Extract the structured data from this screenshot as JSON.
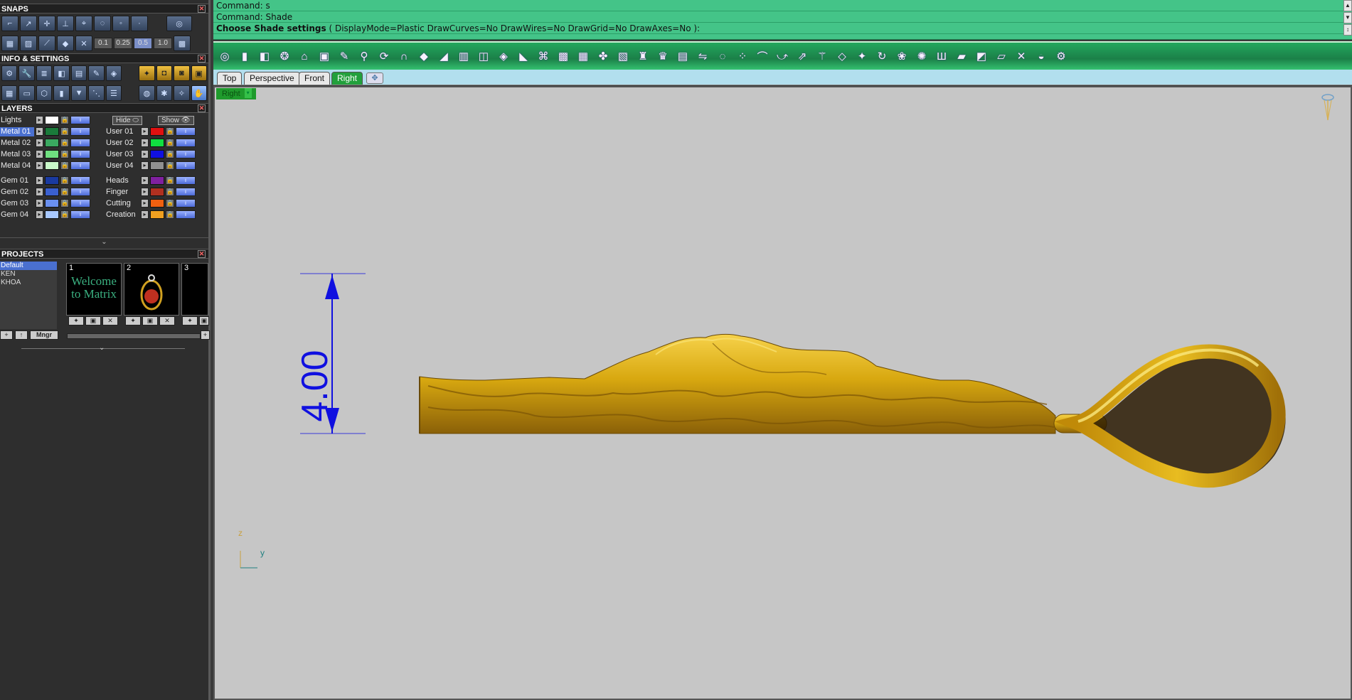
{
  "panels": {
    "snaps": {
      "title": "SNAPS",
      "values": [
        "0.1",
        "0.25",
        "0.5",
        "1.0"
      ],
      "selected_value": "0.5"
    },
    "info": {
      "title": "INFO & SETTINGS"
    },
    "layers": {
      "title": "LAYERS",
      "lights_label": "Lights",
      "hide_label": "Hide",
      "show_label": "Show",
      "left": [
        {
          "name": "Metal 01",
          "color": "#1a7a3a",
          "selected": true
        },
        {
          "name": "Metal 02",
          "color": "#3aa860"
        },
        {
          "name": "Metal 03",
          "color": "#6fe080"
        },
        {
          "name": "Metal 04",
          "color": "#c8f8c8"
        },
        {
          "name": "Gem 01",
          "color": "#1a3aa0"
        },
        {
          "name": "Gem 02",
          "color": "#3a60d0"
        },
        {
          "name": "Gem 03",
          "color": "#6a90f0"
        },
        {
          "name": "Gem 04",
          "color": "#a8c8ff"
        }
      ],
      "right": [
        {
          "name": "User 01",
          "color": "#e01010"
        },
        {
          "name": "User 02",
          "color": "#10e040"
        },
        {
          "name": "User 03",
          "color": "#1010e0"
        },
        {
          "name": "User 04",
          "color": "#909090"
        },
        {
          "name": "Heads",
          "color": "#8020a0"
        },
        {
          "name": "Finger",
          "color": "#b03020"
        },
        {
          "name": "Cutting",
          "color": "#f06010"
        },
        {
          "name": "Creation",
          "color": "#f0a020"
        }
      ]
    },
    "projects": {
      "title": "PROJECTS",
      "items": [
        "Default",
        "KEN",
        "KHOA"
      ],
      "thumbs": [
        {
          "num": "1",
          "text": "Welcome to Matrix"
        },
        {
          "num": "2",
          "text": ""
        },
        {
          "num": "3",
          "text": ""
        }
      ],
      "mngr_label": "Mngr"
    }
  },
  "command": {
    "line1": "Command: s",
    "line2": "Command: Shade",
    "prompt": "Choose Shade settings",
    "options": "( DisplayMode=Plastic  DrawCurves=No  DrawWires=No  DrawGrid=No  DrawAxes=No ):"
  },
  "tabs": [
    "Top",
    "Perspective",
    "Front",
    "Right"
  ],
  "active_tab": "Right",
  "viewport": {
    "label": "Right",
    "dimension": "4.00",
    "axis_z": "z",
    "axis_y": "y"
  },
  "colors": {
    "command_bg": "#44c488",
    "toolbar_bg": "#1b8048",
    "viewport_bg": "#c6c6c6",
    "gold": "#d8a810",
    "dimension_blue": "#1010e0"
  }
}
